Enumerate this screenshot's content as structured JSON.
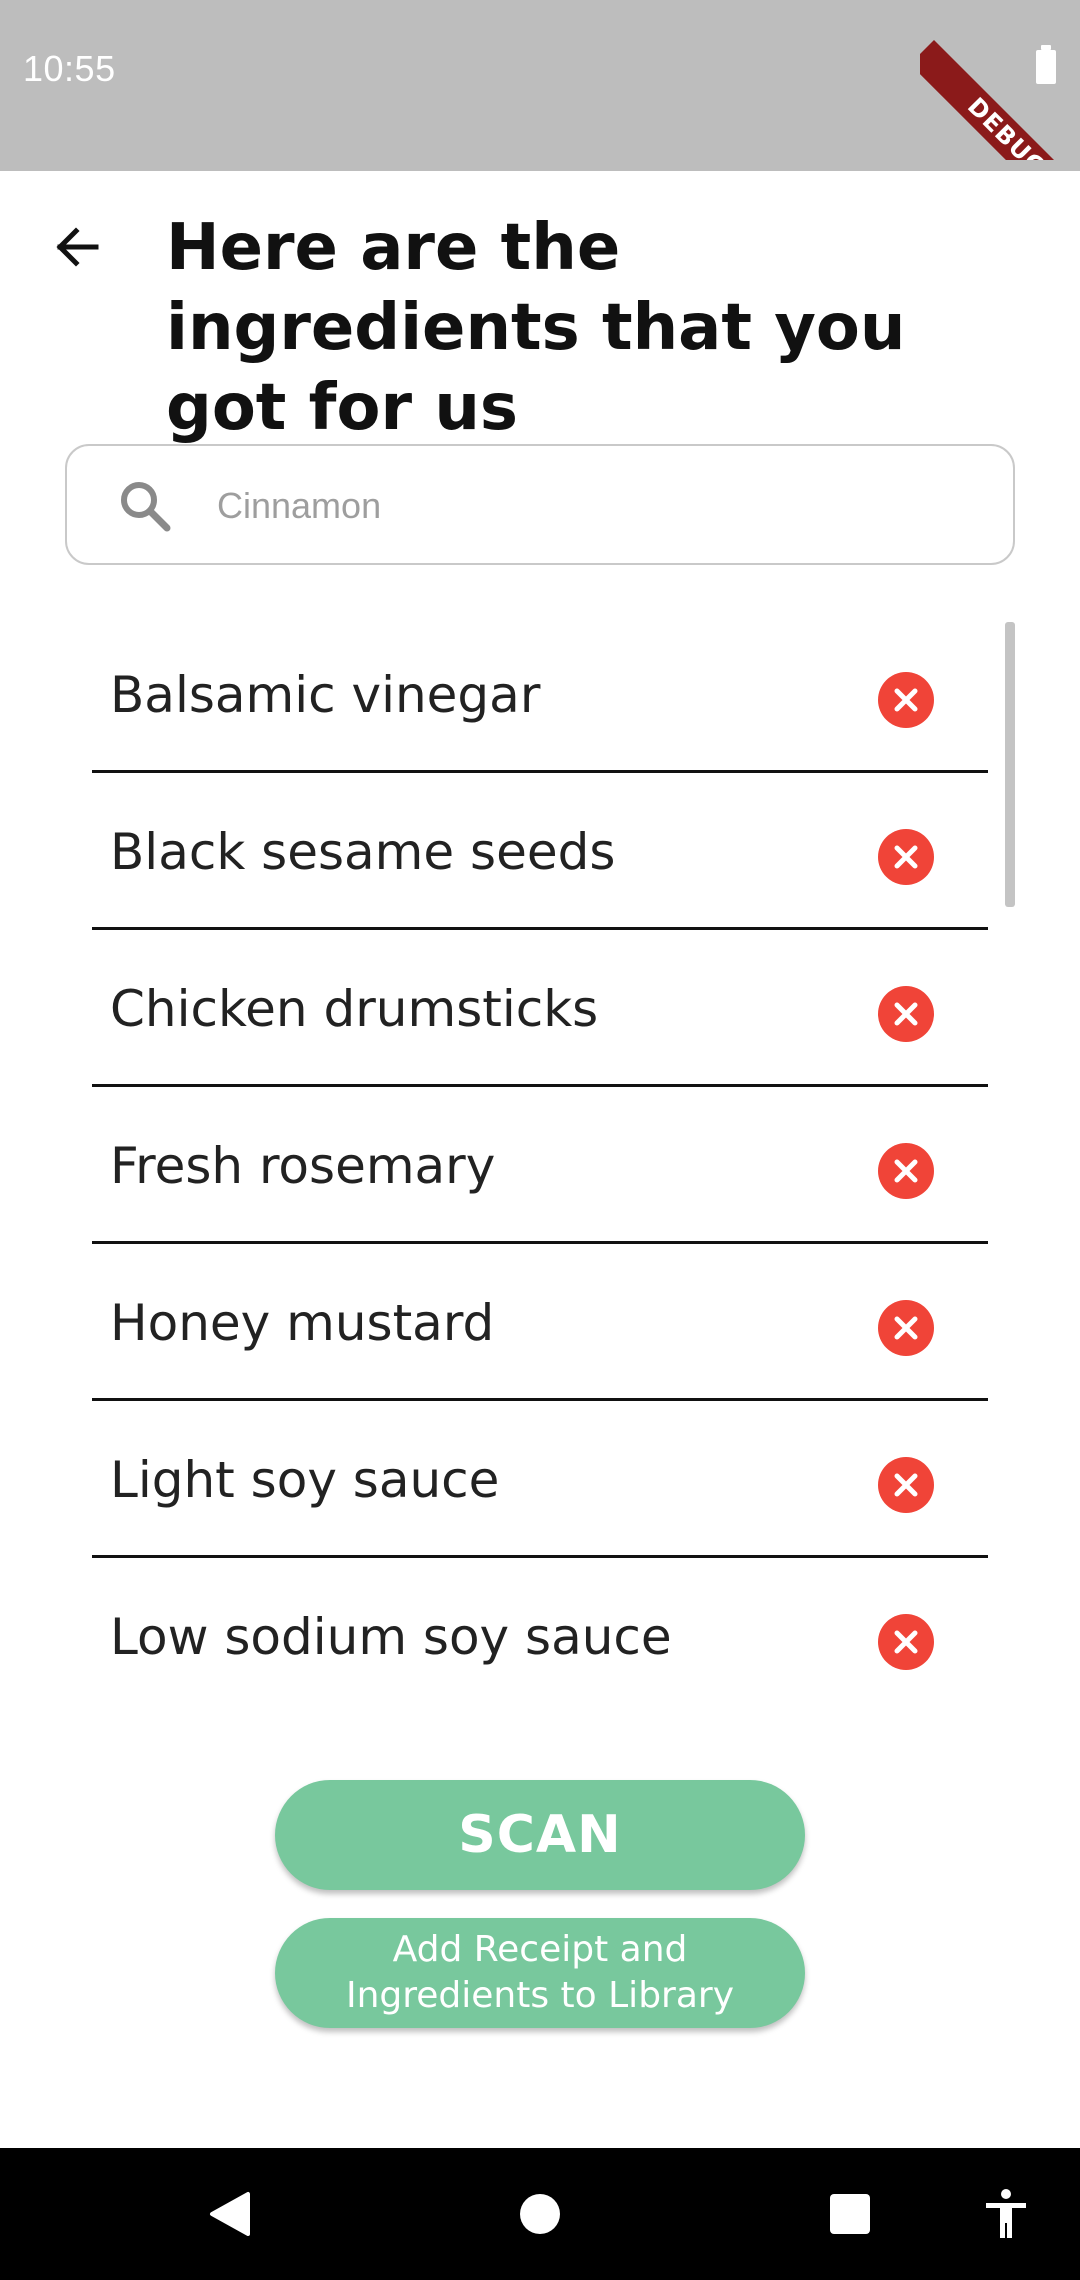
{
  "status_bar": {
    "time": "10:55",
    "debug_label": "DEBUG"
  },
  "header": {
    "title": "Here are the ingredients that you got for us",
    "back_icon": "arrow-left-icon"
  },
  "search": {
    "placeholder": "Cinnamon",
    "value": "",
    "icon": "search-icon"
  },
  "ingredients": [
    {
      "name": "Balsamic vinegar"
    },
    {
      "name": "Black sesame seeds"
    },
    {
      "name": "Chicken drumsticks"
    },
    {
      "name": "Fresh rosemary"
    },
    {
      "name": "Honey mustard"
    },
    {
      "name": "Light soy sauce"
    },
    {
      "name": "Low sodium soy sauce"
    }
  ],
  "actions": {
    "scan_label": "SCAN",
    "add_library_label": "Add Receipt and Ingredients to Library"
  },
  "colors": {
    "accent_green": "#78c89d",
    "remove_red": "#f04438",
    "status_bar": "#bdbdbd",
    "debug_banner": "#8b1a1a"
  },
  "nav_bar": {
    "back": "triangle-back-icon",
    "home": "circle-home-icon",
    "recents": "square-recents-icon",
    "accessibility": "accessibility-icon"
  }
}
